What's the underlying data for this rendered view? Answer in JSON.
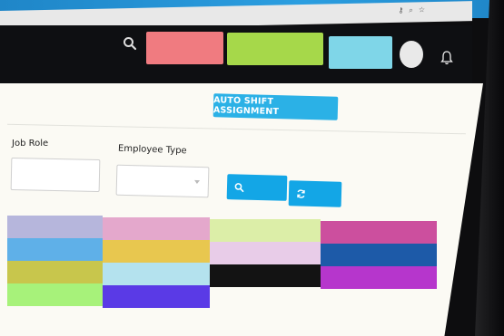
{
  "browser": {
    "icon_names": [
      "key-icon",
      "zoom-icon",
      "star-icon"
    ]
  },
  "header": {
    "blocks": [
      {
        "name": "header-block-red",
        "color": "#f07b80"
      },
      {
        "name": "header-block-green",
        "color": "#a6d84a"
      },
      {
        "name": "header-block-cyan",
        "color": "#7fd6e8"
      }
    ],
    "icons": [
      "search-icon",
      "avatar",
      "bell-icon"
    ]
  },
  "toolbar": {
    "auto_shift_label": "AUTO SHIFT ASSIGNMENT"
  },
  "filters": {
    "job_role_label": "Job Role",
    "job_role_value": "",
    "employee_type_label": "Employee Type",
    "employee_type_value": ""
  },
  "colors": {
    "accent": "#2bb1e6",
    "header_bg": "#0e0f12",
    "content_bg": "#fbfaf4"
  },
  "grid": {
    "columns": [
      [
        "#b6b6dc",
        "#5fb0e8",
        "#c8c64c",
        "#a7f27a"
      ],
      [
        "#e4a8cc",
        "#e8c74f",
        "#b4e2ee",
        "#5a3ae6"
      ],
      [
        "#dceea8",
        "#e8cce8",
        "#131313",
        ""
      ],
      [
        "#cc4f9e",
        "#1d5aa8",
        "#b636cc",
        ""
      ]
    ]
  }
}
